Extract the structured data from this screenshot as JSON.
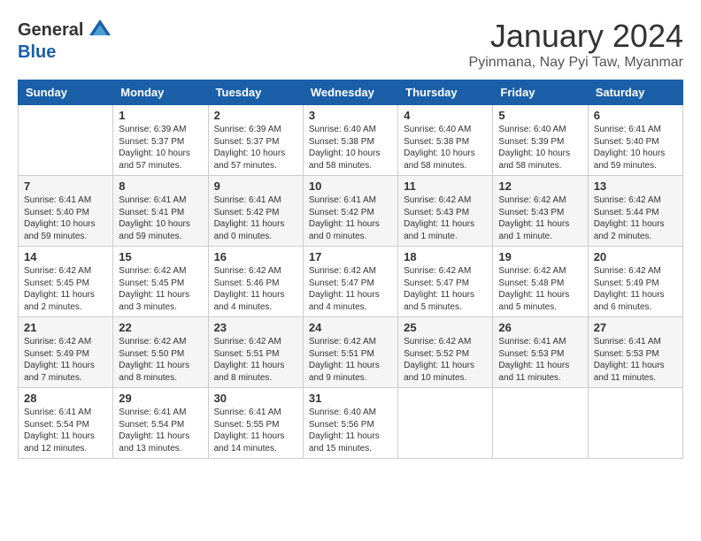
{
  "header": {
    "logo_line1": "General",
    "logo_line2": "Blue",
    "month_title": "January 2024",
    "subtitle": "Pyinmana, Nay Pyi Taw, Myanmar"
  },
  "days_of_week": [
    "Sunday",
    "Monday",
    "Tuesday",
    "Wednesday",
    "Thursday",
    "Friday",
    "Saturday"
  ],
  "weeks": [
    [
      {
        "day": "",
        "info": ""
      },
      {
        "day": "1",
        "info": "Sunrise: 6:39 AM\nSunset: 5:37 PM\nDaylight: 10 hours\nand 57 minutes."
      },
      {
        "day": "2",
        "info": "Sunrise: 6:39 AM\nSunset: 5:37 PM\nDaylight: 10 hours\nand 57 minutes."
      },
      {
        "day": "3",
        "info": "Sunrise: 6:40 AM\nSunset: 5:38 PM\nDaylight: 10 hours\nand 58 minutes."
      },
      {
        "day": "4",
        "info": "Sunrise: 6:40 AM\nSunset: 5:38 PM\nDaylight: 10 hours\nand 58 minutes."
      },
      {
        "day": "5",
        "info": "Sunrise: 6:40 AM\nSunset: 5:39 PM\nDaylight: 10 hours\nand 58 minutes."
      },
      {
        "day": "6",
        "info": "Sunrise: 6:41 AM\nSunset: 5:40 PM\nDaylight: 10 hours\nand 59 minutes."
      }
    ],
    [
      {
        "day": "7",
        "info": "Sunrise: 6:41 AM\nSunset: 5:40 PM\nDaylight: 10 hours\nand 59 minutes."
      },
      {
        "day": "8",
        "info": "Sunrise: 6:41 AM\nSunset: 5:41 PM\nDaylight: 10 hours\nand 59 minutes."
      },
      {
        "day": "9",
        "info": "Sunrise: 6:41 AM\nSunset: 5:42 PM\nDaylight: 11 hours\nand 0 minutes."
      },
      {
        "day": "10",
        "info": "Sunrise: 6:41 AM\nSunset: 5:42 PM\nDaylight: 11 hours\nand 0 minutes."
      },
      {
        "day": "11",
        "info": "Sunrise: 6:42 AM\nSunset: 5:43 PM\nDaylight: 11 hours\nand 1 minute."
      },
      {
        "day": "12",
        "info": "Sunrise: 6:42 AM\nSunset: 5:43 PM\nDaylight: 11 hours\nand 1 minute."
      },
      {
        "day": "13",
        "info": "Sunrise: 6:42 AM\nSunset: 5:44 PM\nDaylight: 11 hours\nand 2 minutes."
      }
    ],
    [
      {
        "day": "14",
        "info": "Sunrise: 6:42 AM\nSunset: 5:45 PM\nDaylight: 11 hours\nand 2 minutes."
      },
      {
        "day": "15",
        "info": "Sunrise: 6:42 AM\nSunset: 5:45 PM\nDaylight: 11 hours\nand 3 minutes."
      },
      {
        "day": "16",
        "info": "Sunrise: 6:42 AM\nSunset: 5:46 PM\nDaylight: 11 hours\nand 4 minutes."
      },
      {
        "day": "17",
        "info": "Sunrise: 6:42 AM\nSunset: 5:47 PM\nDaylight: 11 hours\nand 4 minutes."
      },
      {
        "day": "18",
        "info": "Sunrise: 6:42 AM\nSunset: 5:47 PM\nDaylight: 11 hours\nand 5 minutes."
      },
      {
        "day": "19",
        "info": "Sunrise: 6:42 AM\nSunset: 5:48 PM\nDaylight: 11 hours\nand 5 minutes."
      },
      {
        "day": "20",
        "info": "Sunrise: 6:42 AM\nSunset: 5:49 PM\nDaylight: 11 hours\nand 6 minutes."
      }
    ],
    [
      {
        "day": "21",
        "info": "Sunrise: 6:42 AM\nSunset: 5:49 PM\nDaylight: 11 hours\nand 7 minutes."
      },
      {
        "day": "22",
        "info": "Sunrise: 6:42 AM\nSunset: 5:50 PM\nDaylight: 11 hours\nand 8 minutes."
      },
      {
        "day": "23",
        "info": "Sunrise: 6:42 AM\nSunset: 5:51 PM\nDaylight: 11 hours\nand 8 minutes."
      },
      {
        "day": "24",
        "info": "Sunrise: 6:42 AM\nSunset: 5:51 PM\nDaylight: 11 hours\nand 9 minutes."
      },
      {
        "day": "25",
        "info": "Sunrise: 6:42 AM\nSunset: 5:52 PM\nDaylight: 11 hours\nand 10 minutes."
      },
      {
        "day": "26",
        "info": "Sunrise: 6:41 AM\nSunset: 5:53 PM\nDaylight: 11 hours\nand 11 minutes."
      },
      {
        "day": "27",
        "info": "Sunrise: 6:41 AM\nSunset: 5:53 PM\nDaylight: 11 hours\nand 11 minutes."
      }
    ],
    [
      {
        "day": "28",
        "info": "Sunrise: 6:41 AM\nSunset: 5:54 PM\nDaylight: 11 hours\nand 12 minutes."
      },
      {
        "day": "29",
        "info": "Sunrise: 6:41 AM\nSunset: 5:54 PM\nDaylight: 11 hours\nand 13 minutes."
      },
      {
        "day": "30",
        "info": "Sunrise: 6:41 AM\nSunset: 5:55 PM\nDaylight: 11 hours\nand 14 minutes."
      },
      {
        "day": "31",
        "info": "Sunrise: 6:40 AM\nSunset: 5:56 PM\nDaylight: 11 hours\nand 15 minutes."
      },
      {
        "day": "",
        "info": ""
      },
      {
        "day": "",
        "info": ""
      },
      {
        "day": "",
        "info": ""
      }
    ]
  ]
}
